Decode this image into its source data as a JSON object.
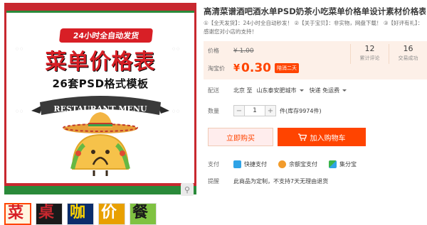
{
  "poster": {
    "ribbon": "24小时全自动发货",
    "headline": "菜单价格表",
    "subheadline": "26套PSD格式模板",
    "banner": "RESTAURANT MENU"
  },
  "thumbnails": [
    {
      "text": "菜",
      "color": "#d81f26",
      "bg": "#fff5e0"
    },
    {
      "text": "桌",
      "color": "#c8282f",
      "bg": "#1a1a1a"
    },
    {
      "text": "咖",
      "color": "#ffd400",
      "bg": "#0b2d6b"
    },
    {
      "text": "价",
      "color": "#ffffff",
      "bg": "#e8a000"
    },
    {
      "text": "餐",
      "color": "#1a1a1a",
      "bg": "#7fc241"
    }
  ],
  "product": {
    "title": "高清菜谱酒吧酒水单PSD奶茶小吃菜单价格单设计素材价格表模板",
    "description": "①【全天发货】：24小时全自动秒发！ ②【关于宝贝】：非实物，网盘下载！ ③【好评有礼】：感谢您对小店的支持！"
  },
  "price": {
    "price_label": "价格",
    "original": "¥ 1.00",
    "taobao_label": "淘宝价",
    "currency": "¥",
    "current": "0.30",
    "promo": "陪消二天"
  },
  "stats": [
    {
      "value": "12",
      "caption": "累计评论"
    },
    {
      "value": "16",
      "caption": "交易成功"
    }
  ],
  "delivery": {
    "label": "配送",
    "route": "北京 至",
    "region": "山东泰安肥城市",
    "method": "快递 免运费"
  },
  "quantity": {
    "label": "数量",
    "minus": "−",
    "value": "1",
    "plus": "+",
    "stock": "件(库存9974件)"
  },
  "buttons": {
    "buy_now": "立即购买",
    "add_cart": "加入购物车"
  },
  "payment": {
    "label": "支付",
    "methods": [
      {
        "name": "快捷支付",
        "color": "#2fa3e6"
      },
      {
        "name": "余额宝支付",
        "color": "#f29b2b"
      },
      {
        "name": "集分宝",
        "color": "#3bb54a"
      }
    ]
  },
  "reminder": {
    "label": "提醒",
    "text": "此商品为定制，不支持7天无理由退货"
  }
}
